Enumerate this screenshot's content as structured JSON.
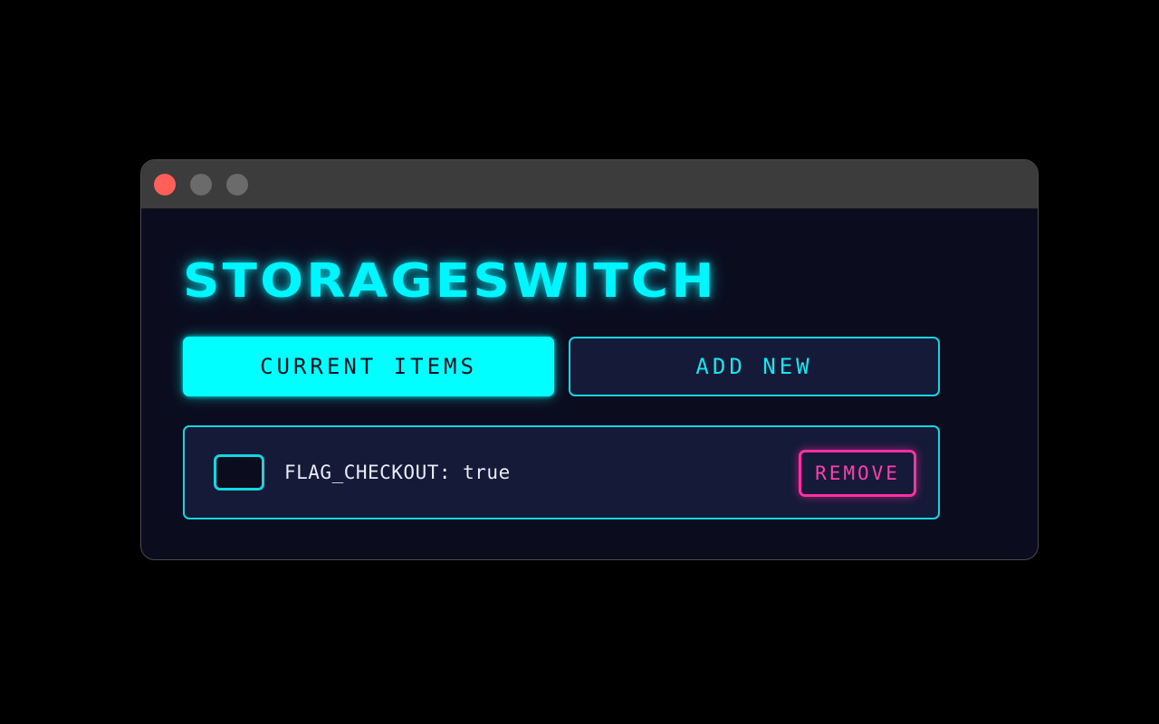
{
  "app": {
    "title": "STORAGESWITCH"
  },
  "tabs": [
    {
      "label": "CURRENT ITEMS",
      "active": true
    },
    {
      "label": "ADD NEW",
      "active": false
    }
  ],
  "items": [
    {
      "text": "FLAG_CHECKOUT: true",
      "checked": false,
      "remove_label": "REMOVE"
    }
  ],
  "colors": {
    "accent": "#00ffff",
    "danger": "#ff2fa3",
    "panel": "#151a38",
    "window_bg": "#0b0d1f",
    "close_button": "#ff5f57"
  }
}
